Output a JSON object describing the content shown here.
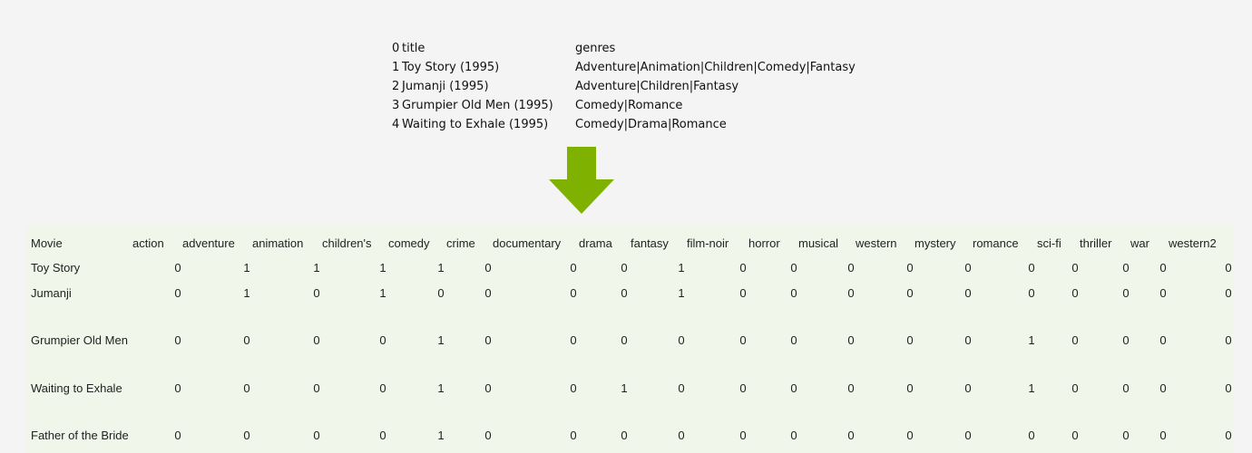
{
  "top_table": {
    "rows": [
      {
        "index": "0",
        "title": "title",
        "genres": "genres"
      },
      {
        "index": "1",
        "title": "Toy Story (1995)",
        "genres": "Adventure|Animation|Children|Comedy|Fantasy"
      },
      {
        "index": "2",
        "title": "Jumanji (1995)",
        "genres": "Adventure|Children|Fantasy"
      },
      {
        "index": "3",
        "title": "Grumpier Old Men (1995)",
        "genres": "Comedy|Romance"
      },
      {
        "index": "4",
        "title": "Waiting to Exhale (1995)",
        "genres": "Comedy|Drama|Romance"
      }
    ]
  },
  "arrow": {
    "icon": "down-arrow-icon",
    "color": "#7fb200"
  },
  "matrix": {
    "header": [
      "Movie",
      "action",
      "adventure",
      "animation",
      "children's",
      "comedy",
      "crime",
      "documentary",
      "drama",
      "fantasy",
      "film-noir",
      "horror",
      "musical",
      "western",
      "mystery",
      "romance",
      "sci-fi",
      "thriller",
      "war",
      "western2"
    ],
    "rows": [
      {
        "movie": "Toy Story",
        "values": [
          "0",
          "1",
          "1",
          "1",
          "1",
          "0",
          "0",
          "0",
          "1",
          "0",
          "0",
          "0",
          "0",
          "0",
          "0",
          "0",
          "0",
          "0",
          "0"
        ]
      },
      {
        "movie": "Jumanji",
        "values": [
          "0",
          "1",
          "0",
          "1",
          "0",
          "0",
          "0",
          "0",
          "1",
          "0",
          "0",
          "0",
          "0",
          "0",
          "0",
          "0",
          "0",
          "0",
          "0"
        ]
      },
      {
        "movie": "Grumpier Old Men",
        "values": [
          "0",
          "0",
          "0",
          "0",
          "1",
          "0",
          "0",
          "0",
          "0",
          "0",
          "0",
          "0",
          "0",
          "0",
          "1",
          "0",
          "0",
          "0",
          "0"
        ]
      },
      {
        "movie": "Waiting to Exhale",
        "values": [
          "0",
          "0",
          "0",
          "0",
          "1",
          "0",
          "0",
          "1",
          "0",
          "0",
          "0",
          "0",
          "0",
          "0",
          "1",
          "0",
          "0",
          "0",
          "0"
        ]
      },
      {
        "movie": "Father of the Bride",
        "values": [
          "0",
          "0",
          "0",
          "0",
          "1",
          "0",
          "0",
          "0",
          "0",
          "0",
          "0",
          "0",
          "0",
          "0",
          "0",
          "0",
          "0",
          "0",
          "0"
        ]
      }
    ],
    "background_color": "#f1f6ea"
  }
}
